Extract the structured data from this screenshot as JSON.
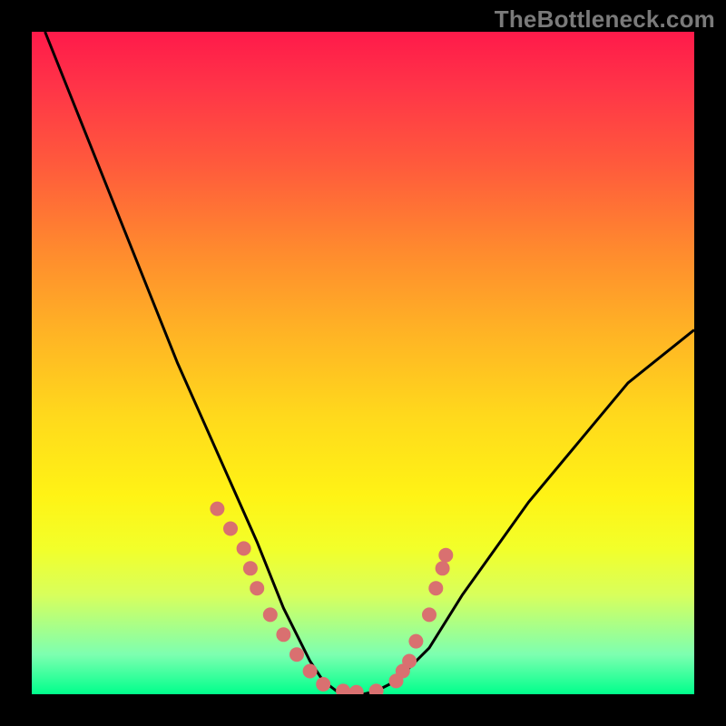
{
  "watermark": "TheBottleneck.com",
  "chart_data": {
    "type": "line",
    "title": "",
    "xlabel": "",
    "ylabel": "",
    "xlim": [
      0,
      100
    ],
    "ylim": [
      0,
      100
    ],
    "grid": false,
    "legend": false,
    "background_gradient": [
      "#ff1a4a",
      "#ff8a2e",
      "#ffd91c",
      "#f2ff2a",
      "#00ff8c"
    ],
    "series": [
      {
        "name": "bottleneck-curve",
        "color": "#000000",
        "x": [
          2,
          6,
          10,
          14,
          18,
          22,
          26,
          30,
          34,
          36,
          38,
          40,
          42,
          44,
          46,
          48,
          50,
          52,
          55,
          60,
          65,
          70,
          75,
          80,
          85,
          90,
          95,
          100
        ],
        "y": [
          100,
          90,
          80,
          70,
          60,
          50,
          41,
          32,
          23,
          18,
          13,
          9,
          5,
          2,
          0.5,
          0,
          0,
          0.5,
          2,
          7,
          15,
          22,
          29,
          35,
          41,
          47,
          51,
          55
        ]
      }
    ],
    "markers": [
      {
        "series": "highlight-dots",
        "color": "#d97070",
        "points": [
          {
            "x": 28,
            "y": 28
          },
          {
            "x": 30,
            "y": 25
          },
          {
            "x": 32,
            "y": 22
          },
          {
            "x": 33,
            "y": 19
          },
          {
            "x": 34,
            "y": 16
          },
          {
            "x": 36,
            "y": 12
          },
          {
            "x": 38,
            "y": 9
          },
          {
            "x": 40,
            "y": 6
          },
          {
            "x": 42,
            "y": 3.5
          },
          {
            "x": 44,
            "y": 1.5
          },
          {
            "x": 47,
            "y": 0.5
          },
          {
            "x": 49,
            "y": 0.3
          },
          {
            "x": 52,
            "y": 0.5
          },
          {
            "x": 55,
            "y": 2
          },
          {
            "x": 56,
            "y": 3.5
          },
          {
            "x": 57,
            "y": 5
          },
          {
            "x": 58,
            "y": 8
          },
          {
            "x": 60,
            "y": 12
          },
          {
            "x": 61,
            "y": 16
          },
          {
            "x": 62,
            "y": 19
          },
          {
            "x": 62.5,
            "y": 21
          }
        ]
      }
    ]
  }
}
